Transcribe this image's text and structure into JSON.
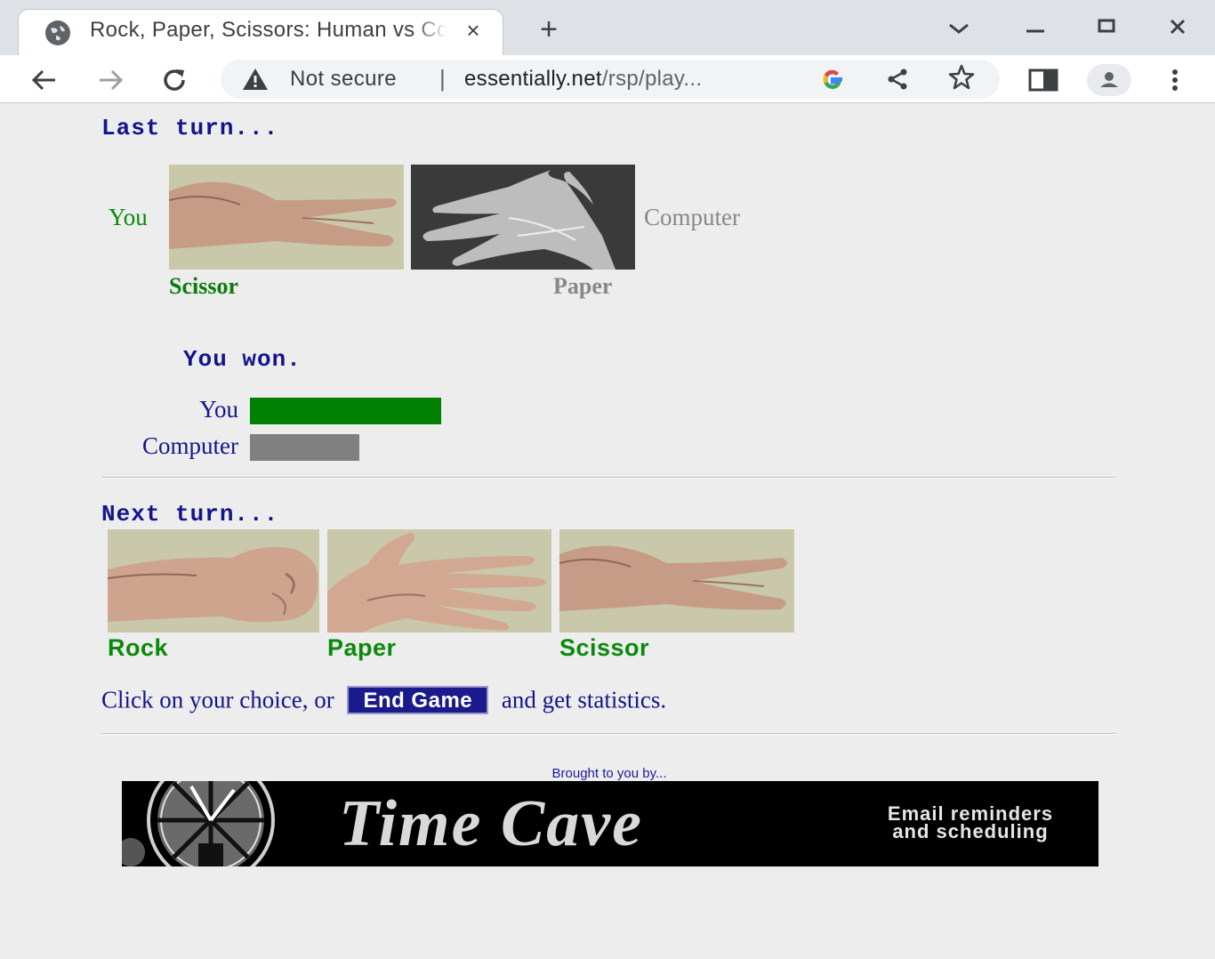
{
  "browser": {
    "tab_title": "Rock, Paper, Scissors: Human vs Computer",
    "tab_close": "×",
    "new_tab": "+",
    "tablist_icon": "chevron-down-icon",
    "not_secure": "Not secure",
    "url_domain": "essentially.net",
    "url_path": "/rsp/play...",
    "google_icon": "G"
  },
  "last_turn": {
    "heading": "Last turn...",
    "you_label": "You",
    "computer_label": "Computer",
    "you_choice": "Scissor",
    "computer_choice": "Paper"
  },
  "result": {
    "text": "You won.",
    "you_label": "You",
    "computer_label": "Computer",
    "you_score": 0.35,
    "computer_score": 0.2,
    "you_color": "#008000",
    "computer_color": "#808080"
  },
  "next_turn": {
    "heading": "Next turn...",
    "choices": [
      {
        "label": "Rock"
      },
      {
        "label": "Paper"
      },
      {
        "label": "Scissor"
      }
    ],
    "instruction_before": "Click on your choice, or",
    "end_button": "End Game",
    "instruction_after": "and get statistics."
  },
  "footer": {
    "brought_by": "Brought to you by...",
    "banner_name": "Time Cave",
    "banner_tagline_1": "Email reminders",
    "banner_tagline_2": "and scheduling"
  }
}
